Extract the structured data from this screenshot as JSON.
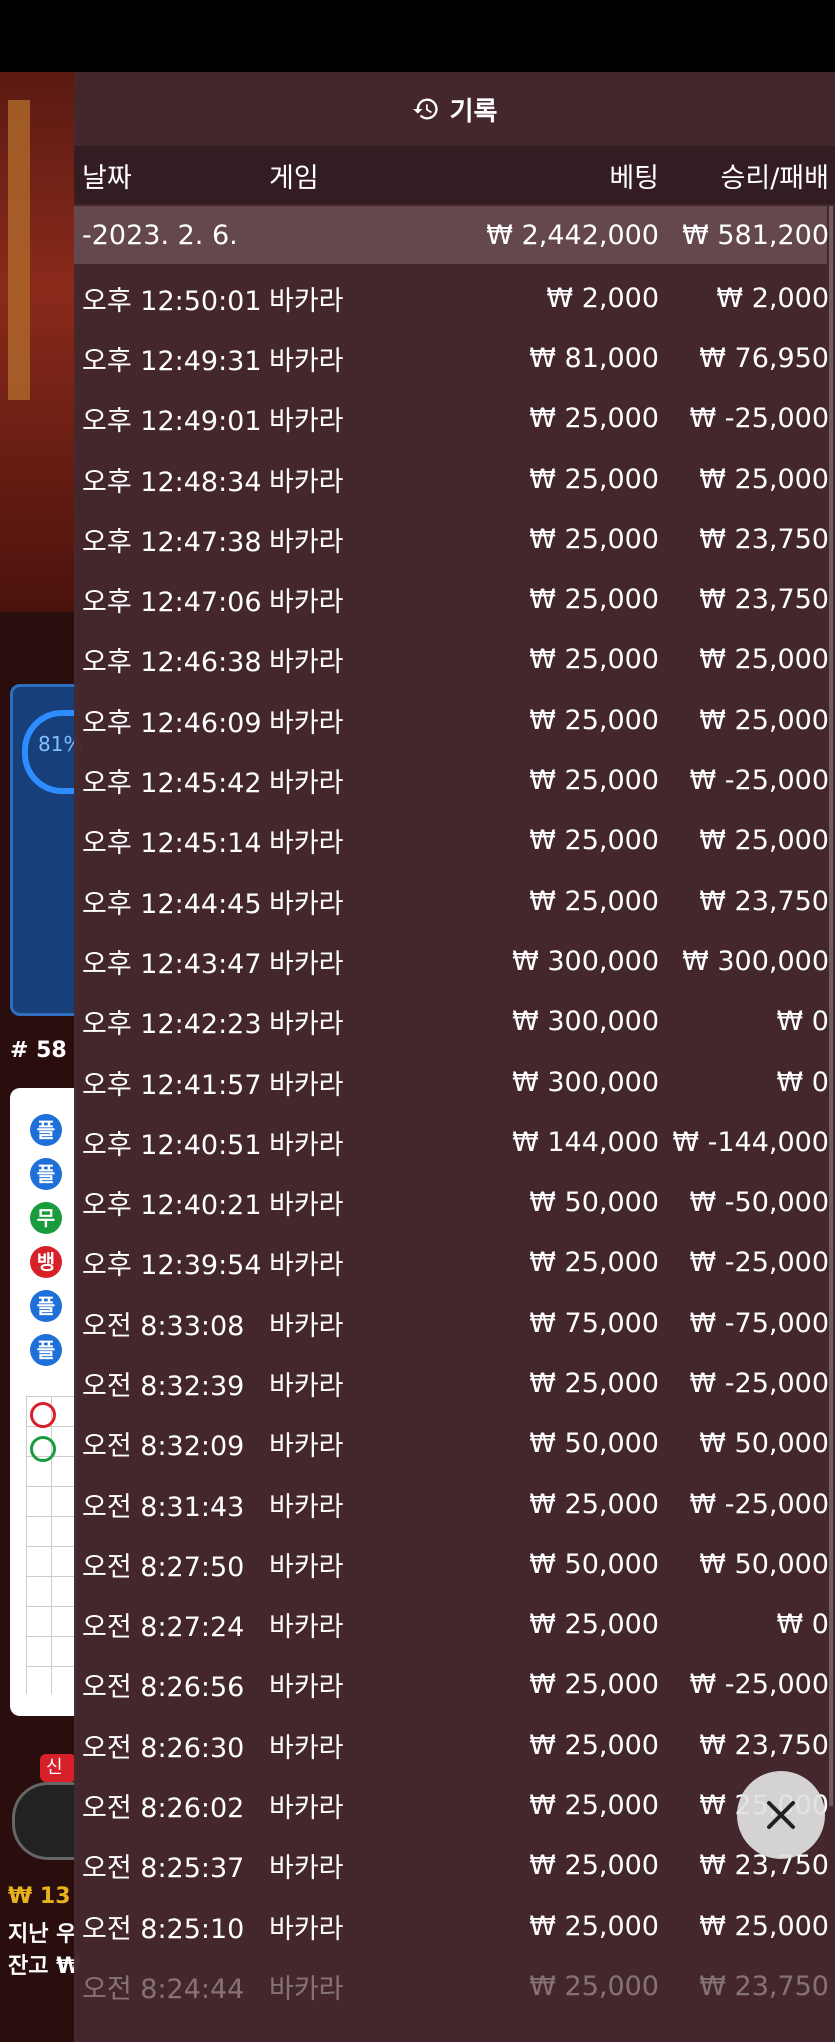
{
  "panel": {
    "title": "기록",
    "icon": "history-icon",
    "columns": {
      "date": "날짜",
      "game": "게임",
      "bet": "베팅",
      "result": "승리/패배"
    },
    "summary": {
      "date": "-2023. 2. 6.",
      "bet": "₩ 2,442,000",
      "result": "₩ 581,200"
    },
    "rows": [
      {
        "time": "오후 12:50:01",
        "game": "바카라",
        "bet": "₩ 2,000",
        "result": "₩ 2,000"
      },
      {
        "time": "오후 12:49:31",
        "game": "바카라",
        "bet": "₩ 81,000",
        "result": "₩ 76,950"
      },
      {
        "time": "오후 12:49:01",
        "game": "바카라",
        "bet": "₩ 25,000",
        "result": "₩ -25,000"
      },
      {
        "time": "오후 12:48:34",
        "game": "바카라",
        "bet": "₩ 25,000",
        "result": "₩ 25,000"
      },
      {
        "time": "오후 12:47:38",
        "game": "바카라",
        "bet": "₩ 25,000",
        "result": "₩ 23,750"
      },
      {
        "time": "오후 12:47:06",
        "game": "바카라",
        "bet": "₩ 25,000",
        "result": "₩ 23,750"
      },
      {
        "time": "오후 12:46:38",
        "game": "바카라",
        "bet": "₩ 25,000",
        "result": "₩ 25,000"
      },
      {
        "time": "오후 12:46:09",
        "game": "바카라",
        "bet": "₩ 25,000",
        "result": "₩ 25,000"
      },
      {
        "time": "오후 12:45:42",
        "game": "바카라",
        "bet": "₩ 25,000",
        "result": "₩ -25,000"
      },
      {
        "time": "오후 12:45:14",
        "game": "바카라",
        "bet": "₩ 25,000",
        "result": "₩ 25,000"
      },
      {
        "time": "오후 12:44:45",
        "game": "바카라",
        "bet": "₩ 25,000",
        "result": "₩ 23,750"
      },
      {
        "time": "오후 12:43:47",
        "game": "바카라",
        "bet": "₩ 300,000",
        "result": "₩ 300,000"
      },
      {
        "time": "오후 12:42:23",
        "game": "바카라",
        "bet": "₩ 300,000",
        "result": "₩ 0"
      },
      {
        "time": "오후 12:41:57",
        "game": "바카라",
        "bet": "₩ 300,000",
        "result": "₩ 0"
      },
      {
        "time": "오후 12:40:51",
        "game": "바카라",
        "bet": "₩ 144,000",
        "result": "₩ -144,000"
      },
      {
        "time": "오후 12:40:21",
        "game": "바카라",
        "bet": "₩ 50,000",
        "result": "₩ -50,000"
      },
      {
        "time": "오후 12:39:54",
        "game": "바카라",
        "bet": "₩ 25,000",
        "result": "₩ -25,000"
      },
      {
        "time": "오전 8:33:08",
        "game": "바카라",
        "bet": "₩ 75,000",
        "result": "₩ -75,000"
      },
      {
        "time": "오전 8:32:39",
        "game": "바카라",
        "bet": "₩ 25,000",
        "result": "₩ -25,000"
      },
      {
        "time": "오전 8:32:09",
        "game": "바카라",
        "bet": "₩ 50,000",
        "result": "₩ 50,000"
      },
      {
        "time": "오전 8:31:43",
        "game": "바카라",
        "bet": "₩ 25,000",
        "result": "₩ -25,000"
      },
      {
        "time": "오전 8:27:50",
        "game": "바카라",
        "bet": "₩ 50,000",
        "result": "₩ 50,000"
      },
      {
        "time": "오전 8:27:24",
        "game": "바카라",
        "bet": "₩ 25,000",
        "result": "₩ 0"
      },
      {
        "time": "오전 8:26:56",
        "game": "바카라",
        "bet": "₩ 25,000",
        "result": "₩ -25,000"
      },
      {
        "time": "오전 8:26:30",
        "game": "바카라",
        "bet": "₩ 25,000",
        "result": "₩ 23,750"
      },
      {
        "time": "오전 8:26:02",
        "game": "바카라",
        "bet": "₩ 25,000",
        "result": "₩ 25,000"
      },
      {
        "time": "오전 8:25:37",
        "game": "바카라",
        "bet": "₩ 25,000",
        "result": "₩ 23,750"
      },
      {
        "time": "오전 8:25:10",
        "game": "바카라",
        "bet": "₩ 25,000",
        "result": "₩ 25,000"
      },
      {
        "time": "오전 8:24:44",
        "game": "바카라",
        "bet": "₩ 25,000",
        "result": "₩ 23,750"
      }
    ]
  },
  "background": {
    "stat_percent": "81%",
    "shoe_number": "# 58",
    "road_badges": [
      "플",
      "플",
      "무",
      "뱅",
      "플",
      "플"
    ],
    "new_tag": "신",
    "balance_line1": "₩ 13",
    "balance_line2": "지난 우",
    "balance_line3": "잔고 ₩"
  },
  "close_button": {
    "icon": "close-icon"
  },
  "colors": {
    "panel_bg": "#46282e",
    "accent_blue": "#1e6fd8",
    "accent_red": "#d8202a",
    "gold": "#e8b21a"
  }
}
